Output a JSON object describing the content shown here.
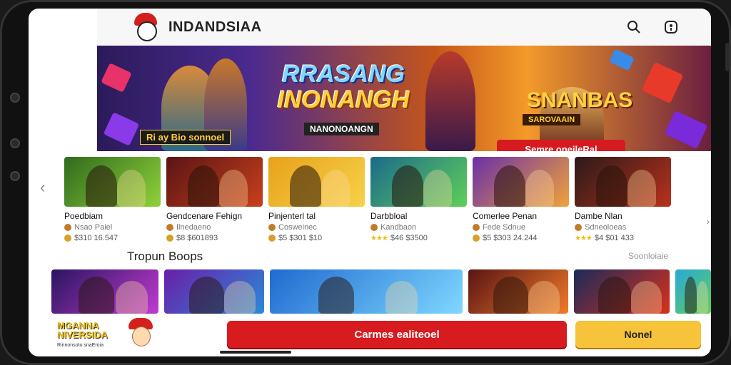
{
  "header": {
    "title": "INDANDSIAA"
  },
  "hero": {
    "title_line1": "RRASANG",
    "title_line2": "INONANGH",
    "subtitle": "NANONOANGN",
    "left_tag": "Ri ay Bio sonnoel",
    "right_title": "SNANBAS",
    "right_subtitle": "SAROVAAIN",
    "cta": "Semre oneileRal"
  },
  "games": [
    {
      "name": "Poedbiam",
      "sub": "Nsao Paiel",
      "meta": "$310 16.547",
      "stars": false,
      "colors": [
        "#2f6a1e",
        "#8fd23a"
      ]
    },
    {
      "name": "Gendcenare Fehign",
      "sub": "Ilnedaeno",
      "meta": "$8 $601893",
      "stars": false,
      "colors": [
        "#5a1414",
        "#c8401c"
      ]
    },
    {
      "name": "Pinjenterl tal",
      "sub": "Cosweinec",
      "meta": "$5 $301 $10",
      "stars": false,
      "colors": [
        "#e8a21a",
        "#f6d24a"
      ]
    },
    {
      "name": "Darbbloal",
      "sub": "Kandbaon",
      "meta": "$46 $3500",
      "stars": true,
      "colors": [
        "#1b6a8a",
        "#5fcf5a"
      ]
    },
    {
      "name": "Comerlee Penan",
      "sub": "Fede Sdnue",
      "meta": "$5 $303 24.244",
      "stars": false,
      "colors": [
        "#6a2fa8",
        "#f0a23a"
      ]
    },
    {
      "name": "Dambe Nlan",
      "sub": "Sdneoloeas",
      "meta": "$4 $01 433",
      "stars": true,
      "colors": [
        "#2a1a1a",
        "#b8311c"
      ]
    }
  ],
  "section": {
    "title": "Tropun Boops",
    "link": "Soonloiaie"
  },
  "tiles": [
    {
      "colors": [
        "#2a1560",
        "#c03ad0"
      ],
      "w": 150
    },
    {
      "colors": [
        "#6a1ea8",
        "#2a8ad8"
      ],
      "w": 140
    },
    {
      "colors": [
        "#1f6ad0",
        "#7fd8ff"
      ],
      "w": 270
    },
    {
      "colors": [
        "#5a1414",
        "#f07a2a"
      ],
      "w": 140
    },
    {
      "colors": [
        "#1a2a5a",
        "#d8301c"
      ],
      "w": 134
    },
    {
      "colors": [
        "#2aa8d8",
        "#5fcf5a"
      ],
      "w": 50
    }
  ],
  "bottom": {
    "logo_line1": "MGANNA",
    "logo_line2": "NIVERSIDA",
    "logo_tag": "Rinnonsoto snaEroia",
    "cta": "Carmes ealiteoel",
    "secondary": "Nonel"
  }
}
